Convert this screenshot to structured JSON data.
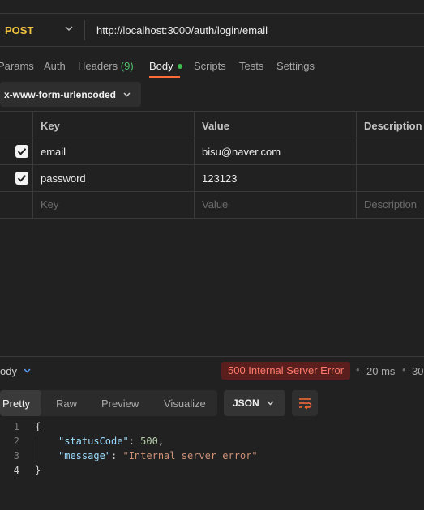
{
  "request": {
    "method": "POST",
    "url": "http://localhost:3000/auth/login/email"
  },
  "tabs": {
    "params": "Params",
    "auth": "Auth",
    "headers": "Headers",
    "headers_count": "(9)",
    "body": "Body",
    "scripts": "Scripts",
    "tests": "Tests",
    "settings": "Settings"
  },
  "body_type": "x-www-form-urlencoded",
  "kv_table": {
    "headers": [
      "Key",
      "Value",
      "Description"
    ],
    "rows": [
      {
        "key": "email",
        "value": "bisu@naver.com",
        "checked": true
      },
      {
        "key": "password",
        "value": "123123",
        "checked": true
      }
    ],
    "placeholders": {
      "key": "Key",
      "value": "Value",
      "description": "Description"
    }
  },
  "response": {
    "label": "ody",
    "status": "500 Internal Server Error",
    "time": "20 ms",
    "size": "30",
    "views": [
      "Pretty",
      "Raw",
      "Preview",
      "Visualize"
    ],
    "format": "JSON",
    "code": {
      "lines": [
        "1",
        "2",
        "3",
        "4"
      ],
      "open_brace": "{",
      "close_brace": "}",
      "status_key": "\"statusCode\"",
      "status_val": "500",
      "message_key": "\"message\"",
      "message_val": "\"Internal server error\""
    }
  },
  "colors": {
    "method": "#f3c53e",
    "accent": "#ff6c37",
    "status_bg": "#5a1f1c",
    "status_fg": "#ff7a6b"
  }
}
